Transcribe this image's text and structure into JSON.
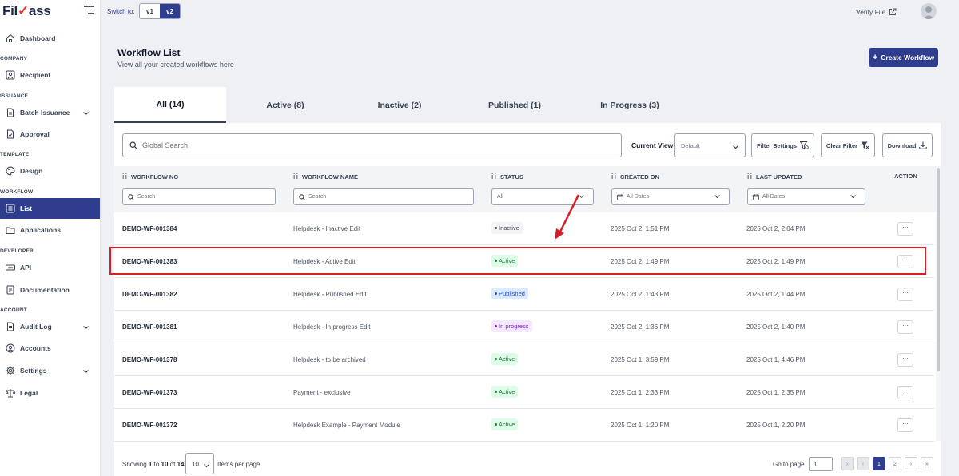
{
  "brand": {
    "logo_text": "FilPass"
  },
  "sidebar": {
    "dashboard": "Dashboard",
    "sec_company": "COMPANY",
    "recipient": "Recipient",
    "sec_issuance": "ISSUANCE",
    "batch_issuance": "Batch Issuance",
    "approval": "Approval",
    "sec_template": "TEMPLATE",
    "design": "Design",
    "sec_workflow": "WORKFLOW",
    "list": "List",
    "applications": "Applications",
    "sec_developer": "DEVELOPER",
    "api": "API",
    "documentation": "Documentation",
    "sec_account": "ACCOUNT",
    "audit_log": "Audit Log",
    "accounts": "Accounts",
    "settings": "Settings",
    "legal": "Legal"
  },
  "topbar": {
    "switch_label": "Switch to:",
    "v1": "v1",
    "v2": "v2",
    "verify": "Verify File"
  },
  "header": {
    "title": "Workflow List",
    "subtitle": "View all your created workflows here",
    "create_button": "Create Workflow"
  },
  "tabs": {
    "all": "All (14)",
    "active": "Active (8)",
    "inactive": "Inactive (2)",
    "published": "Published (1)",
    "in_progress": "In Progress (3)"
  },
  "toolbar": {
    "search_placeholder": "Global Search",
    "current_view_label": "Current View:",
    "current_view_value": "Default",
    "filter_settings": "Filter Settings",
    "clear_filter": "Clear Filter",
    "download": "Download"
  },
  "table": {
    "headers": {
      "no": "WORKFLOW NO",
      "name": "WORKFLOW NAME",
      "status": "STATUS",
      "created": "CREATED ON",
      "updated": "LAST UPDATED",
      "action": "ACTION"
    },
    "filters": {
      "no": "Search",
      "name": "Search",
      "status": "All",
      "created": "All Dates",
      "updated": "All Dates"
    },
    "rows": [
      {
        "no": "DEMO-WF-001384",
        "name": "Helpdesk - Inactive Edit",
        "status": "Inactive",
        "created": "2025 Oct 2, 1:51 PM",
        "updated": "2025 Oct 2, 2:04 PM",
        "action": "···"
      },
      {
        "no": "DEMO-WF-001383",
        "name": "Helpdesk - Active Edit",
        "status": "Active",
        "created": "2025 Oct 2, 1:49 PM",
        "updated": "2025 Oct 2, 1:49 PM",
        "action": "···"
      },
      {
        "no": "DEMO-WF-001382",
        "name": "Helpdesk - Published Edit",
        "status": "Published",
        "created": "2025 Oct 2, 1:43 PM",
        "updated": "2025 Oct 2, 1:44 PM",
        "action": "···"
      },
      {
        "no": "DEMO-WF-001381",
        "name": "Helpdesk - In progress Edit",
        "status": "In progress",
        "created": "2025 Oct 2, 1:36 PM",
        "updated": "2025 Oct 2, 1:40 PM",
        "action": "···"
      },
      {
        "no": "DEMO-WF-001378",
        "name": "Helpdesk - to be archived",
        "status": "Active",
        "created": "2025 Oct 1, 3:59 PM",
        "updated": "2025 Oct 1, 4:46 PM",
        "action": "···"
      },
      {
        "no": "DEMO-WF-001373",
        "name": "Payment - exclusive",
        "status": "Active",
        "created": "2025 Oct 1, 2:33 PM",
        "updated": "2025 Oct 1, 2:35 PM",
        "action": "···"
      },
      {
        "no": "DEMO-WF-001372",
        "name": "Helpdesk Example - Payment Module",
        "status": "Active",
        "created": "2025 Oct 1, 1:20 PM",
        "updated": "2025 Oct 1, 2:20 PM",
        "action": "···"
      }
    ]
  },
  "footer": {
    "showing_prefix": "Showing",
    "from": "1",
    "to_word": "to",
    "to": "10",
    "of_word": "of",
    "total": "14",
    "per_page_value": "10",
    "per_page_label": "Items per page",
    "goto_label": "Go to page",
    "goto_value": "1",
    "pages": {
      "first": "«",
      "prev": "‹",
      "p1": "1",
      "p2": "2",
      "next": "›",
      "last": "»"
    }
  },
  "colors": {
    "primary": "#2f3d8f",
    "highlight": "#d61f26",
    "active_bg": "#dcfce7",
    "published_bg": "#dbeafe",
    "progress_bg": "#f3e8ff"
  }
}
